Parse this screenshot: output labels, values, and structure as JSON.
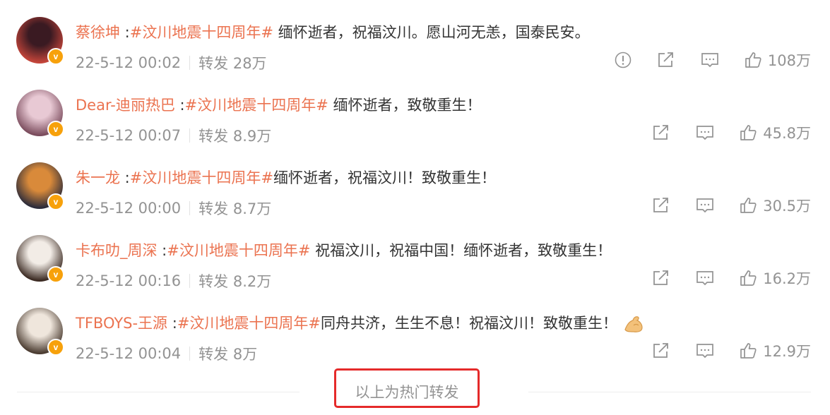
{
  "reposts": [
    {
      "user": "蔡徐坤",
      "hashtag": "#汶川地震十四周年#",
      "text": " 缅怀逝者，祝福汶川。愿山河无恙，国泰民安。",
      "time": "22-5-12 00:02",
      "repost": "转发 28万",
      "likes": "108万",
      "has_report": true,
      "avatar_colors": [
        "#3a1a22",
        "#c4453a"
      ]
    },
    {
      "user": "Dear-迪丽热巴",
      "hashtag": "#汶川地震十四周年#",
      "text": " 缅怀逝者，致敬重生！",
      "time": "22-5-12 00:07",
      "repost": "转发 8.9万",
      "likes": "45.8万",
      "has_report": false,
      "avatar_colors": [
        "#e8c9d4",
        "#7a4b5c"
      ]
    },
    {
      "user": "朱一龙",
      "hashtag": "#汶川地震十四周年#",
      "text": "缅怀逝者，祝福汶川！致敬重生！",
      "time": "22-5-12 00:00",
      "repost": "转发 8.7万",
      "likes": "30.5万",
      "has_report": false,
      "avatar_colors": [
        "#d98a3a",
        "#2b2b3a"
      ]
    },
    {
      "user": "卡布叻_周深",
      "hashtag": "#汶川地震十四周年#",
      "text": " 祝福汶川，祝福中国！缅怀逝者，致敬重生！",
      "time": "22-5-12 00:16",
      "repost": "转发 8.2万",
      "likes": "16.2万",
      "has_report": false,
      "avatar_colors": [
        "#f2ece6",
        "#3b2a22"
      ]
    },
    {
      "user": "TFBOYS-王源",
      "hashtag": "#汶川地震十四周年#",
      "text": "同舟共济，生生不息！祝福汶川！致敬重生！",
      "time": "22-5-12 00:04",
      "repost": "转发 8万",
      "likes": "12.9万",
      "has_report": false,
      "has_emoji": true,
      "emoji": "muscle-emoji",
      "avatar_colors": [
        "#efe6dc",
        "#4a3b30"
      ]
    }
  ],
  "footer": {
    "hot_label": "以上为热门转发"
  },
  "icons": {
    "verified": "verified-badge",
    "report": "warning-circle-icon",
    "share": "share-icon",
    "comment": "comment-icon",
    "like": "thumbs-up-icon"
  },
  "colors": {
    "username": "#eb7350",
    "hashtag": "#eb7350",
    "meta": "#939393",
    "highlight_box": "#e52a2a",
    "badge": "#f7a10b"
  }
}
